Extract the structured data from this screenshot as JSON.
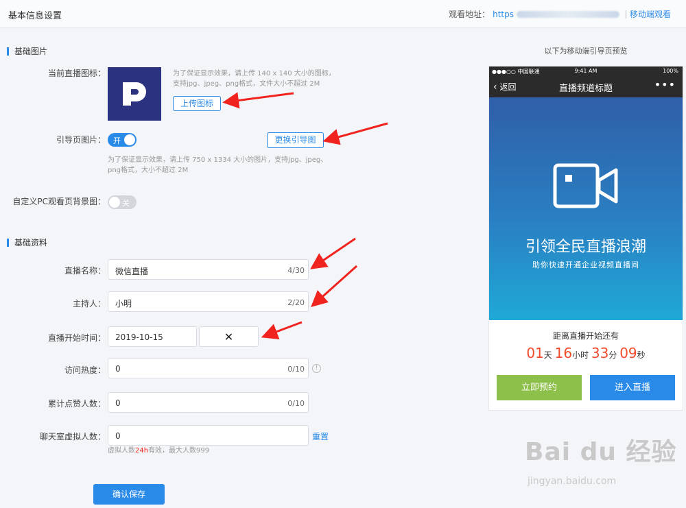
{
  "header": {
    "title": "基本信息设置",
    "watch_label": "观看地址：",
    "watch_url": "https",
    "mobile_link": "移动端观看"
  },
  "sections": {
    "images_title": "基础图片",
    "info_title": "基础资料"
  },
  "images": {
    "icon_label": "当前直播图标：",
    "icon_hint_1": "为了保证显示效果，请上传 140 x 140 大小的图标，",
    "icon_hint_2": "支持jpg、jpeg、png格式，文件大小不超过 2M",
    "upload_icon_btn": "上传图标",
    "guide_label": "引导页图片：",
    "guide_toggle": "开",
    "change_guide_btn": "更换引导图",
    "guide_hint_1": "为了保证显示效果，请上传 750 x 1334 大小的图片，支持jpg、jpeg、",
    "guide_hint_2": "png格式，大小不超过 2M",
    "pc_bg_label": "自定义PC观看页背景图：",
    "pc_bg_toggle": "关"
  },
  "info": {
    "name_label": "直播名称：",
    "name_value": "微信直播",
    "name_count": "4/30",
    "host_label": "主持人：",
    "host_value": "小明",
    "host_count": "2/20",
    "start_label": "直播开始时间：",
    "start_date": "2019-10-15",
    "clear_symbol": "✕",
    "heat_label": "访问热度：",
    "heat_value": "0",
    "heat_count": "0/10",
    "info_icon": "!",
    "likes_label": "累计点赞人数：",
    "likes_value": "0",
    "likes_count": "0/10",
    "virtual_label": "聊天室虚拟人数：",
    "virtual_value": "0",
    "reset_link": "重置",
    "virtual_hint_pre": "虚拟人数",
    "virtual_hint_highlight": "24h",
    "virtual_hint_post": "有效，最大人数999",
    "save_btn": "确认保存"
  },
  "preview": {
    "title": "以下为移动端引导页预览",
    "status_carrier": "●●●○○ 中国联通",
    "status_time": "9:41 AM",
    "status_battery": "100%",
    "back_label": "返回",
    "page_title": "直播频道标题",
    "more": "•••",
    "headline": "引领全民直播浪潮",
    "subline": "助你快速开通企业视频直播间",
    "countdown_label": "距离直播开始还有",
    "days": "01",
    "days_unit": "天",
    "hours": "16",
    "hours_unit": "小时",
    "minutes": "33",
    "minutes_unit": "分",
    "seconds": "09",
    "seconds_unit": "秒",
    "reserve_btn": "立即预约",
    "enter_btn": "进入直播"
  },
  "watermark": {
    "brand": "Bai du 经验",
    "url": "jingyan.baidu.com"
  },
  "colors": {
    "accent": "#2a8ae8",
    "arrow": "#f0231e",
    "countdown": "#f04a2a",
    "reserve": "#8cc04a"
  }
}
